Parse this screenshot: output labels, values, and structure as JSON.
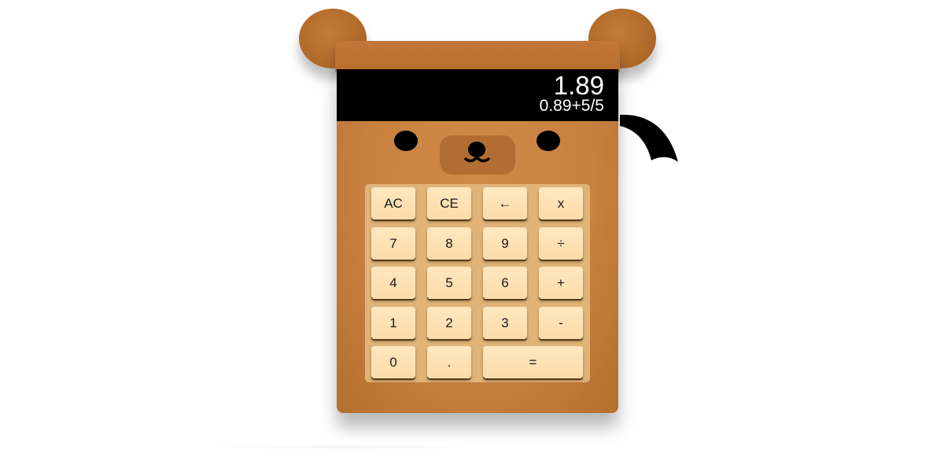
{
  "display": {
    "result": "1.89",
    "expression": "0.89+5/5"
  },
  "keys": {
    "ac": "AC",
    "ce": "CE",
    "backspace": "←",
    "multiply": "x",
    "seven": "7",
    "eight": "8",
    "nine": "9",
    "divide": "÷",
    "four": "4",
    "five": "5",
    "six": "6",
    "plus": "+",
    "one": "1",
    "two": "2",
    "three": "3",
    "minus": "-",
    "zero": "0",
    "decimal": ".",
    "equals": "="
  },
  "colors": {
    "body": "#c98140",
    "ears": "#b36b2a",
    "keypad": "#e0b478",
    "key": "#fcdca9",
    "display": "#000000",
    "display_text": "#ffffff"
  }
}
